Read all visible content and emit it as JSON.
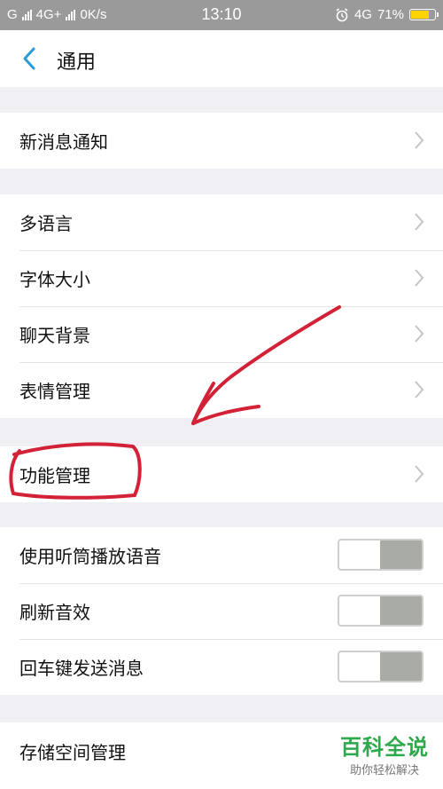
{
  "status_bar": {
    "carrier1": "G",
    "carrier2": "4G+",
    "speed": "0K/s",
    "time": "13:10",
    "network": "4G",
    "battery": "71%",
    "battery_level": 0.71
  },
  "header": {
    "back_icon": "chevron-left-icon",
    "title": "通用"
  },
  "groups": [
    {
      "items": [
        {
          "label": "新消息通知"
        }
      ]
    },
    {
      "items": [
        {
          "label": "多语言"
        },
        {
          "label": "字体大小"
        },
        {
          "label": "聊天背景"
        },
        {
          "label": "表情管理"
        }
      ]
    },
    {
      "items": [
        {
          "label": "功能管理"
        }
      ]
    },
    {
      "items": [
        {
          "label": "使用听筒播放语音",
          "toggle": false
        },
        {
          "label": "刷新音效",
          "toggle": false
        },
        {
          "label": "回车键发送消息",
          "toggle": false
        }
      ]
    },
    {
      "items": [
        {
          "label": "存储空间管理"
        }
      ]
    }
  ],
  "watermark": {
    "main": "百科全说",
    "sub": "助你轻松解决"
  },
  "colors": {
    "accent": "#2b9bd8",
    "annotation": "#d32237",
    "toggle_off_track": "#a8aca4",
    "watermark": "#2ea84c"
  }
}
